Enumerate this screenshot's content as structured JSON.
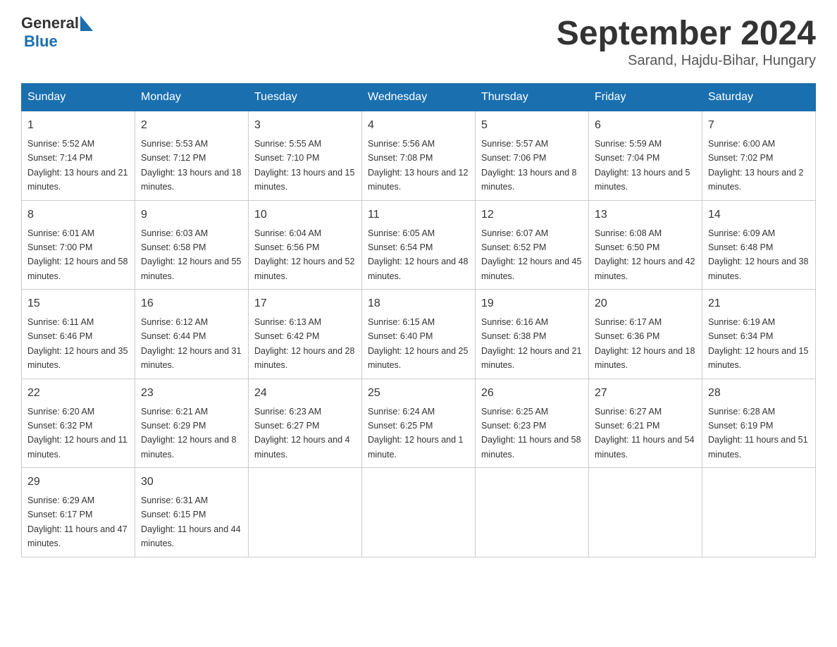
{
  "header": {
    "logo": {
      "general": "General",
      "blue": "Blue"
    },
    "title": "September 2024",
    "subtitle": "Sarand, Hajdu-Bihar, Hungary"
  },
  "days_of_week": [
    "Sunday",
    "Monday",
    "Tuesday",
    "Wednesday",
    "Thursday",
    "Friday",
    "Saturday"
  ],
  "weeks": [
    [
      {
        "date": "1",
        "sunrise": "5:52 AM",
        "sunset": "7:14 PM",
        "daylight": "13 hours and 21 minutes."
      },
      {
        "date": "2",
        "sunrise": "5:53 AM",
        "sunset": "7:12 PM",
        "daylight": "13 hours and 18 minutes."
      },
      {
        "date": "3",
        "sunrise": "5:55 AM",
        "sunset": "7:10 PM",
        "daylight": "13 hours and 15 minutes."
      },
      {
        "date": "4",
        "sunrise": "5:56 AM",
        "sunset": "7:08 PM",
        "daylight": "13 hours and 12 minutes."
      },
      {
        "date": "5",
        "sunrise": "5:57 AM",
        "sunset": "7:06 PM",
        "daylight": "13 hours and 8 minutes."
      },
      {
        "date": "6",
        "sunrise": "5:59 AM",
        "sunset": "7:04 PM",
        "daylight": "13 hours and 5 minutes."
      },
      {
        "date": "7",
        "sunrise": "6:00 AM",
        "sunset": "7:02 PM",
        "daylight": "13 hours and 2 minutes."
      }
    ],
    [
      {
        "date": "8",
        "sunrise": "6:01 AM",
        "sunset": "7:00 PM",
        "daylight": "12 hours and 58 minutes."
      },
      {
        "date": "9",
        "sunrise": "6:03 AM",
        "sunset": "6:58 PM",
        "daylight": "12 hours and 55 minutes."
      },
      {
        "date": "10",
        "sunrise": "6:04 AM",
        "sunset": "6:56 PM",
        "daylight": "12 hours and 52 minutes."
      },
      {
        "date": "11",
        "sunrise": "6:05 AM",
        "sunset": "6:54 PM",
        "daylight": "12 hours and 48 minutes."
      },
      {
        "date": "12",
        "sunrise": "6:07 AM",
        "sunset": "6:52 PM",
        "daylight": "12 hours and 45 minutes."
      },
      {
        "date": "13",
        "sunrise": "6:08 AM",
        "sunset": "6:50 PM",
        "daylight": "12 hours and 42 minutes."
      },
      {
        "date": "14",
        "sunrise": "6:09 AM",
        "sunset": "6:48 PM",
        "daylight": "12 hours and 38 minutes."
      }
    ],
    [
      {
        "date": "15",
        "sunrise": "6:11 AM",
        "sunset": "6:46 PM",
        "daylight": "12 hours and 35 minutes."
      },
      {
        "date": "16",
        "sunrise": "6:12 AM",
        "sunset": "6:44 PM",
        "daylight": "12 hours and 31 minutes."
      },
      {
        "date": "17",
        "sunrise": "6:13 AM",
        "sunset": "6:42 PM",
        "daylight": "12 hours and 28 minutes."
      },
      {
        "date": "18",
        "sunrise": "6:15 AM",
        "sunset": "6:40 PM",
        "daylight": "12 hours and 25 minutes."
      },
      {
        "date": "19",
        "sunrise": "6:16 AM",
        "sunset": "6:38 PM",
        "daylight": "12 hours and 21 minutes."
      },
      {
        "date": "20",
        "sunrise": "6:17 AM",
        "sunset": "6:36 PM",
        "daylight": "12 hours and 18 minutes."
      },
      {
        "date": "21",
        "sunrise": "6:19 AM",
        "sunset": "6:34 PM",
        "daylight": "12 hours and 15 minutes."
      }
    ],
    [
      {
        "date": "22",
        "sunrise": "6:20 AM",
        "sunset": "6:32 PM",
        "daylight": "12 hours and 11 minutes."
      },
      {
        "date": "23",
        "sunrise": "6:21 AM",
        "sunset": "6:29 PM",
        "daylight": "12 hours and 8 minutes."
      },
      {
        "date": "24",
        "sunrise": "6:23 AM",
        "sunset": "6:27 PM",
        "daylight": "12 hours and 4 minutes."
      },
      {
        "date": "25",
        "sunrise": "6:24 AM",
        "sunset": "6:25 PM",
        "daylight": "12 hours and 1 minute."
      },
      {
        "date": "26",
        "sunrise": "6:25 AM",
        "sunset": "6:23 PM",
        "daylight": "11 hours and 58 minutes."
      },
      {
        "date": "27",
        "sunrise": "6:27 AM",
        "sunset": "6:21 PM",
        "daylight": "11 hours and 54 minutes."
      },
      {
        "date": "28",
        "sunrise": "6:28 AM",
        "sunset": "6:19 PM",
        "daylight": "11 hours and 51 minutes."
      }
    ],
    [
      {
        "date": "29",
        "sunrise": "6:29 AM",
        "sunset": "6:17 PM",
        "daylight": "11 hours and 47 minutes."
      },
      {
        "date": "30",
        "sunrise": "6:31 AM",
        "sunset": "6:15 PM",
        "daylight": "11 hours and 44 minutes."
      },
      null,
      null,
      null,
      null,
      null
    ]
  ]
}
